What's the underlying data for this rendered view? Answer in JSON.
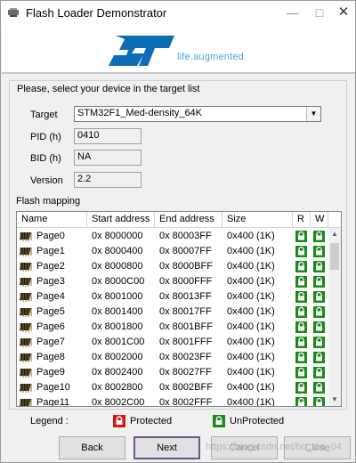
{
  "window": {
    "title": "Flash Loader Demonstrator"
  },
  "banner": {
    "tagline": "life.augmented"
  },
  "prompt": "Please, select your device in the target list",
  "target": {
    "label": "Target",
    "value": "STM32F1_Med-density_64K"
  },
  "pid": {
    "label": "PID  (h)",
    "value": "0410"
  },
  "bid": {
    "label": "BID  (h)",
    "value": "NA"
  },
  "version": {
    "label": "Version",
    "value": "2.2"
  },
  "flash": {
    "label": "Flash mapping",
    "columns": [
      "Name",
      "Start address",
      "End address",
      "Size",
      "R",
      "W"
    ],
    "rows": [
      {
        "name": "Page0",
        "start": "0x 8000000",
        "end": "0x 80003FF",
        "size": "0x400 (1K)"
      },
      {
        "name": "Page1",
        "start": "0x 8000400",
        "end": "0x 80007FF",
        "size": "0x400 (1K)"
      },
      {
        "name": "Page2",
        "start": "0x 8000800",
        "end": "0x 8000BFF",
        "size": "0x400 (1K)"
      },
      {
        "name": "Page3",
        "start": "0x 8000C00",
        "end": "0x 8000FFF",
        "size": "0x400 (1K)"
      },
      {
        "name": "Page4",
        "start": "0x 8001000",
        "end": "0x 80013FF",
        "size": "0x400 (1K)"
      },
      {
        "name": "Page5",
        "start": "0x 8001400",
        "end": "0x 80017FF",
        "size": "0x400 (1K)"
      },
      {
        "name": "Page6",
        "start": "0x 8001800",
        "end": "0x 8001BFF",
        "size": "0x400 (1K)"
      },
      {
        "name": "Page7",
        "start": "0x 8001C00",
        "end": "0x 8001FFF",
        "size": "0x400 (1K)"
      },
      {
        "name": "Page8",
        "start": "0x 8002000",
        "end": "0x 80023FF",
        "size": "0x400 (1K)"
      },
      {
        "name": "Page9",
        "start": "0x 8002400",
        "end": "0x 80027FF",
        "size": "0x400 (1K)"
      },
      {
        "name": "Page10",
        "start": "0x 8002800",
        "end": "0x 8002BFF",
        "size": "0x400 (1K)"
      },
      {
        "name": "Page11",
        "start": "0x 8002C00",
        "end": "0x 8002FFF",
        "size": "0x400 (1K)"
      }
    ]
  },
  "legend": {
    "label": "Legend :",
    "protected": "Protected",
    "unprotected": "UnProtected"
  },
  "buttons": {
    "back": "Back",
    "next": "Next",
    "cancel": "Cancel",
    "close": "Close"
  },
  "watermark": "https://blog.csdn.net/bo_dia_04",
  "colors": {
    "unprotected": "#1a8a1a",
    "protected": "#d11a1a",
    "brand": "#0c6cb5",
    "tagline": "#4aa4d8"
  },
  "icons": {
    "app": "flash-loader-icon",
    "page": "memory-chip-icon",
    "lock": "lock-icon"
  }
}
